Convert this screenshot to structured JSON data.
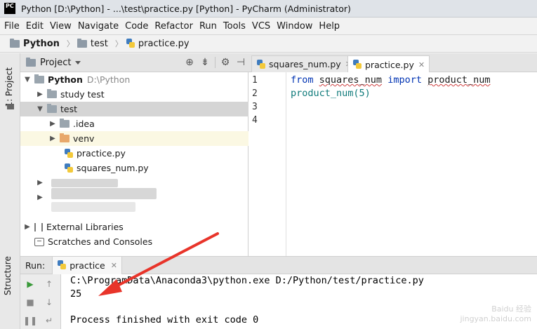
{
  "window": {
    "logo_text": "PC",
    "title": "Python [D:\\Python] - ...\\test\\practice.py [Python] - PyCharm (Administrator)"
  },
  "menu": [
    "File",
    "Edit",
    "View",
    "Navigate",
    "Code",
    "Refactor",
    "Run",
    "Tools",
    "VCS",
    "Window",
    "Help"
  ],
  "breadcrumb": [
    "Python",
    "test",
    "practice.py"
  ],
  "left_strip": {
    "project_tab": "1: Project",
    "structure_tab": "Structure"
  },
  "project_panel": {
    "title": "Project",
    "root": {
      "name": "Python",
      "path": "D:\\Python"
    },
    "items": [
      {
        "label": "study test"
      },
      {
        "label": "test"
      },
      {
        "label": ".idea"
      },
      {
        "label": "venv"
      },
      {
        "label": "practice.py"
      },
      {
        "label": "squares_num.py"
      },
      {
        "label": "External Libraries"
      },
      {
        "label": "Scratches and Consoles"
      }
    ]
  },
  "editor": {
    "tabs": [
      {
        "label": "squares_num.py"
      },
      {
        "label": "practice.py",
        "active": true
      }
    ],
    "line_numbers": [
      "1",
      "2",
      "3",
      "4"
    ],
    "code": {
      "l1_kw1": "from",
      "l1_mod": "squares_num",
      "l1_kw2": "import",
      "l1_name": "product_num",
      "l2": "product_num(5)"
    }
  },
  "run": {
    "label": "Run:",
    "tab": "practice",
    "output": [
      "C:\\ProgramData\\Anaconda3\\python.exe D:/Python/test/practice.py",
      "25",
      "",
      "Process finished with exit code 0"
    ]
  },
  "watermark": {
    "line1": "Baidu 经验",
    "line2": "jingyan.baidu.com"
  },
  "colors": {
    "keyword": "#0033b3",
    "annotation_arrow": "#e8342a",
    "selection": "#d5d5d5"
  }
}
